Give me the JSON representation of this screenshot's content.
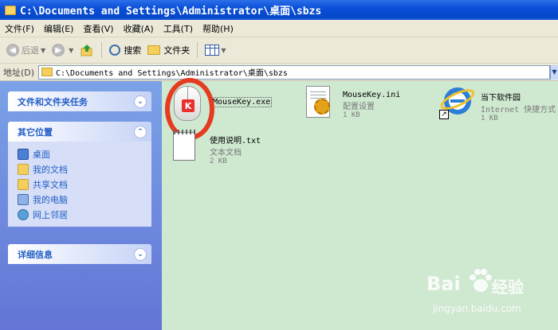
{
  "window": {
    "title": "C:\\Documents and Settings\\Administrator\\桌面\\sbzs"
  },
  "menu": {
    "items": [
      "文件(F)",
      "编辑(E)",
      "查看(V)",
      "收藏(A)",
      "工具(T)",
      "帮助(H)"
    ]
  },
  "toolbar": {
    "back_label": "后退",
    "search_label": "搜索",
    "folders_label": "文件夹"
  },
  "address": {
    "label": "地址(D)",
    "value": "C:\\Documents and Settings\\Administrator\\桌面\\sbzs"
  },
  "taskpane": {
    "tasks_title": "文件和文件夹任务",
    "places_title": "其它位置",
    "places": [
      {
        "label": "桌面",
        "icon": "desktop-icon"
      },
      {
        "label": "我的文档",
        "icon": "my-documents-icon"
      },
      {
        "label": "共享文档",
        "icon": "shared-documents-icon"
      },
      {
        "label": "我的电脑",
        "icon": "my-computer-icon"
      },
      {
        "label": "网上邻居",
        "icon": "network-places-icon"
      }
    ],
    "details_title": "详细信息"
  },
  "files": [
    {
      "name": "MouseKey.exe",
      "type": "",
      "size": "",
      "icon": "mouse-icon",
      "highlighted": true
    },
    {
      "name": "MouseKey.ini",
      "type": "配置设置",
      "size": "1 KB",
      "icon": "config-file-icon"
    },
    {
      "name": "当下软件园",
      "type": "Internet 快捷方式",
      "size": "1 KB",
      "icon": "ie-shortcut-icon"
    },
    {
      "name": "使用说明.txt",
      "type": "文本文档",
      "size": "2 KB",
      "icon": "text-file-icon"
    }
  ],
  "watermark": {
    "brand_left": "Bai",
    "brand_right": "经验",
    "url": "jingyan.baidu.com"
  },
  "colors": {
    "titlebar": "#0a4fd8",
    "taskpane": "#6375d6",
    "main_bg": "#cfe8d0",
    "highlight_ring": "#e53b20"
  }
}
